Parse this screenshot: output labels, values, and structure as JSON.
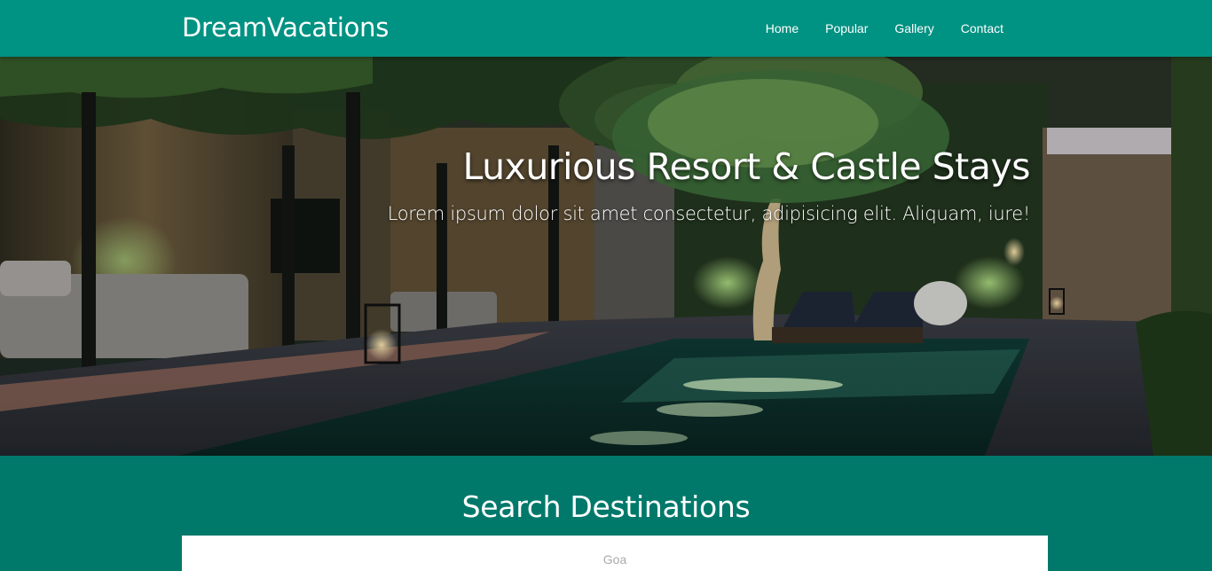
{
  "navbar": {
    "brand": "DreamVacations",
    "links": [
      "Home",
      "Popular",
      "Gallery",
      "Contact"
    ]
  },
  "hero": {
    "title": "Luxurious Resort & Castle Stays",
    "subtitle": "Lorem ipsum dolor sit amet consectetur, adipisicing elit. Aliquam, iure!"
  },
  "search": {
    "title": "Search Destinations",
    "placeholder": "Goa"
  },
  "colors": {
    "navbar": "#009282",
    "section": "#00796b",
    "text": "#ffffff"
  }
}
